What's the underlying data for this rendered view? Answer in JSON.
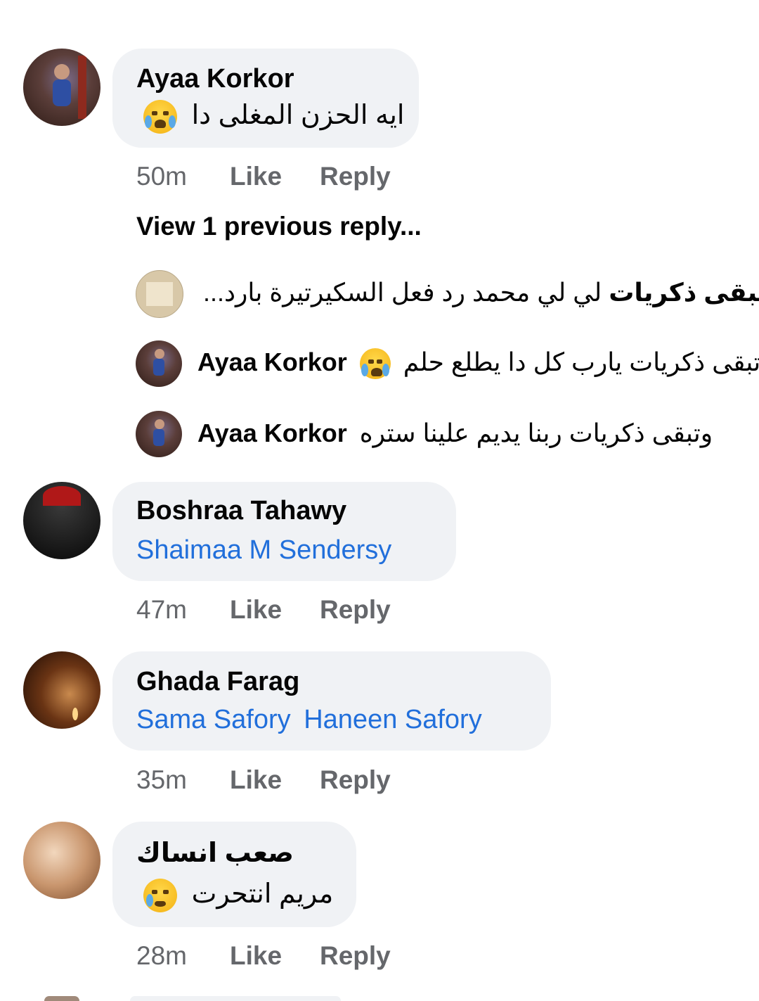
{
  "comments": [
    {
      "author": "Ayaa Korkor",
      "text": "ايه الحزن المغلى دا",
      "emoji": "loudly-crying-face-icon",
      "time": "50m",
      "like_label": "Like",
      "reply_label": "Reply"
    },
    {
      "author": "Boshraa Tahawy",
      "tags": [
        "Shaimaa M Sendersy"
      ],
      "time": "47m",
      "like_label": "Like",
      "reply_label": "Reply"
    },
    {
      "author": "Ghada Farag",
      "tags": [
        "Sama Safory",
        "Haneen Safory"
      ],
      "time": "35m",
      "like_label": "Like",
      "reply_label": "Reply"
    },
    {
      "author": "صعب انساك",
      "text": "مريم انتحرت",
      "emoji": "sad-but-relieved-face-icon",
      "time": "28m",
      "like_label": "Like",
      "reply_label": "Reply"
    }
  ],
  "view_previous": "View 1 previous reply...",
  "replies": [
    {
      "author": "وتبقى ذكريات",
      "text": "لي لي محمد رد فعل السكيرتيرة بارد..."
    },
    {
      "author": "Ayaa Korkor",
      "text": "وتبقى ذكريات يارب كل دا يطلع حلم",
      "emoji": "loudly-crying-face-icon"
    },
    {
      "author": "Ayaa Korkor",
      "text": "وتبقى ذكريات ربنا يديم علينا ستره"
    }
  ],
  "colors": {
    "bubble": "#f0f2f5",
    "link": "#216fdb",
    "meta": "#65676b",
    "text": "#050505"
  }
}
